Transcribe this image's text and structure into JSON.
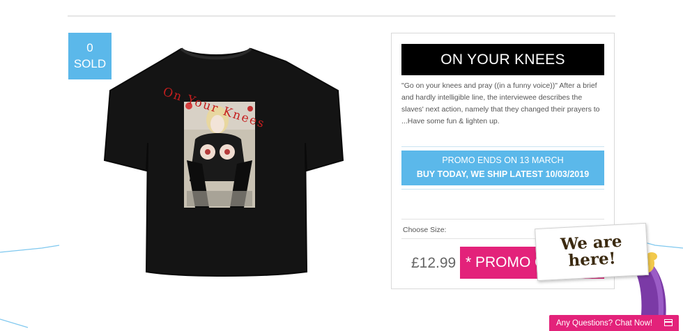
{
  "product": {
    "sold_count": "0",
    "sold_label": "SOLD",
    "image_alt": "Black t-shirt printed with On Your Knees artwork",
    "print_text": "On Your Knees"
  },
  "panel": {
    "title": "ON YOUR KNEES",
    "description": "\"Go on your knees and pray ((in a funny voice))\" After a brief and hardly intelligible line, the interviewee describes the slaves' next action, namely that they changed their prayers to ...Have some fun & lighten up.",
    "promo_line1": "PROMO ENDS ON 13 MARCH",
    "promo_line2": "BUY TODAY, WE SHIP LATEST 10/03/2019",
    "size_label": "Choose Size:",
    "price": "£12.99",
    "buy_label": "* PROMO O"
  },
  "sticker": {
    "line1": "We are",
    "line2": "here!"
  },
  "chat": {
    "label": "Any Questions? Chat Now!",
    "icon": "chat-window-icon"
  },
  "colors": {
    "accent_blue": "#5bb8ea",
    "accent_pink": "#e3227a",
    "title_bg": "#000000"
  }
}
